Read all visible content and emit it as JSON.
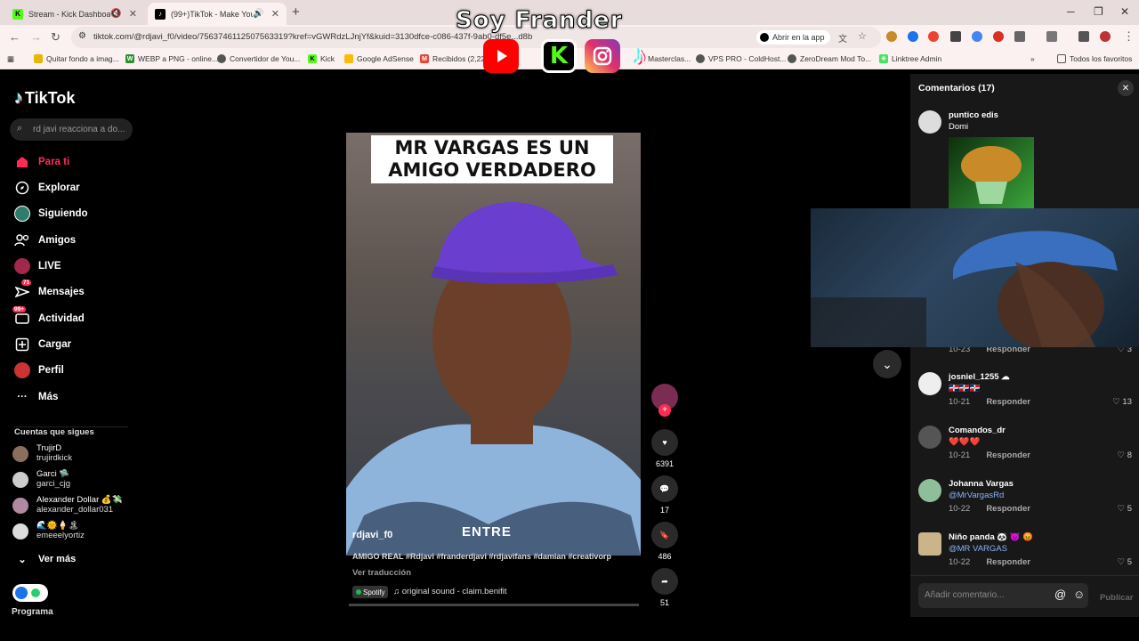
{
  "browser": {
    "tabs": [
      {
        "title": "Stream - Kick Dashboard",
        "active": false
      },
      {
        "title": "(99+)TikTok - Make Your Day",
        "active": true
      }
    ],
    "url": "tiktok.com/@rdjavi_f0/video/7563746112507563319?kref=vGWRdzLJnjYf&kuid=3130dfce-c086-437f-9ab0-df5e...d8b",
    "open_in_app": "Abrir en la app",
    "bookmarks": [
      "Quitar fondo a imag...",
      "WEBP a PNG - online...",
      "Convertidor de You...",
      "Kick",
      "Google AdSense",
      "Recibidos (2,229...",
      "Masterclas...",
      "VPS PRO - ColdHost...",
      "ZeroDream Mod To...",
      "Linktree Admin"
    ],
    "all_bookmarks": "Todos los favoritos"
  },
  "overlay": {
    "title": "Soy Frander"
  },
  "sidebar": {
    "logo": "TikTok",
    "search_placeholder": "rd javi reacciona a do...",
    "nav": [
      {
        "label": "Para ti",
        "icon": "home-icon",
        "active": true
      },
      {
        "label": "Explorar",
        "icon": "compass-icon"
      },
      {
        "label": "Siguiendo",
        "icon": "following-icon"
      },
      {
        "label": "Amigos",
        "icon": "friends-icon"
      },
      {
        "label": "LIVE",
        "icon": "live-icon"
      },
      {
        "label": "Mensajes",
        "icon": "messages-icon",
        "badge": "71"
      },
      {
        "label": "Actividad",
        "icon": "activity-icon",
        "badge": "99+"
      },
      {
        "label": "Cargar",
        "icon": "upload-icon"
      },
      {
        "label": "Perfil",
        "icon": "profile-icon"
      },
      {
        "label": "Más",
        "icon": "more-icon"
      }
    ],
    "following_header": "Cuentas que sigues",
    "following": [
      {
        "name": "TrujirD",
        "user": "trujirdkick"
      },
      {
        "name": "Garci 🛸",
        "user": "garci_cjg"
      },
      {
        "name": "Alexander Dollar 💰💸",
        "user": "alexander_dollar031"
      },
      {
        "name": "🌊🌞🍦🏝",
        "user": "emeeelyortiz"
      }
    ],
    "see_more": "Ver más",
    "program": "Programa"
  },
  "video": {
    "caption": "MR VARGAS ES UN AMIGO VERDADERO",
    "overlay_word": "ENTRE",
    "author": "rdjavi_f0",
    "description": "AMIGO REAL #Rdjavi #franderdjavi #rdjavifans #damian #creativorp",
    "translate": "Ver traducción",
    "spotify": "Spotify",
    "sound": "original sound - claim.benifit",
    "likes": "6391",
    "comments": "17",
    "saves": "486",
    "shares": "51"
  },
  "comments_panel": {
    "title": "Comentarios (17)",
    "reply_label": "Responder",
    "items": [
      {
        "name": "puntico edis",
        "text": "Domi",
        "date": "",
        "likes": ""
      },
      {
        "name": "",
        "text": "",
        "date": "10-23",
        "likes": "3"
      },
      {
        "name": "josniel_1255 ☁",
        "text": "🇩🇴🇩🇴🇩🇴",
        "date": "10-21",
        "likes": "13"
      },
      {
        "name": "Comandos_dr",
        "text": "❤️❤️❤️",
        "date": "10-21",
        "likes": "8"
      },
      {
        "name": "Johanna Vargas",
        "text": "@MrVargasRd",
        "date": "10-22",
        "likes": "5"
      },
      {
        "name": "Niño panda 🐼 😈 😡",
        "text": "@MR VARGAS",
        "date": "10-22",
        "likes": "5"
      }
    ],
    "input_placeholder": "Añadir comentario...",
    "publish": "Publicar"
  }
}
